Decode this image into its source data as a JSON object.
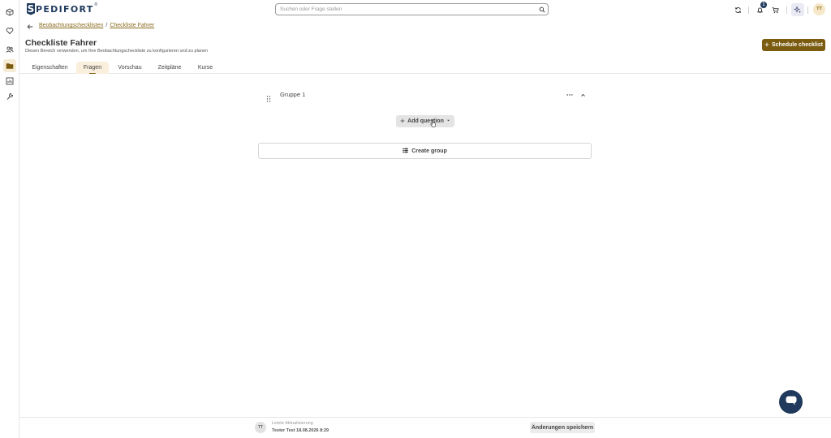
{
  "brand": {
    "name": "PEDIFORT",
    "mark": "S",
    "reg": "®"
  },
  "rail": {
    "items": [
      {
        "name": "cube-icon"
      },
      {
        "name": "heart-icon"
      },
      {
        "name": "users-icon"
      },
      {
        "name": "folder-icon",
        "active": true
      },
      {
        "name": "chart-icon"
      },
      {
        "name": "tools-icon"
      }
    ]
  },
  "search": {
    "placeholder": "Suchen oder Frage stellen",
    "value": ""
  },
  "topbar": {
    "notification_count": "1",
    "avatar_initials": "TT"
  },
  "breadcrumb": {
    "items": [
      "Beobachtungschecklisten",
      "Checkliste Fahrer"
    ],
    "separator": "/"
  },
  "header": {
    "title": "Checkliste Fahrer",
    "description": "Diesen Bereich verwenden, um Ihre Beobachtungscheckliste zu konfigurieren und zu planen",
    "schedule_label": "Schedule checklist"
  },
  "tabs": [
    {
      "label": "Eigenschaften",
      "active": false
    },
    {
      "label": "Fragen",
      "active": true
    },
    {
      "label": "Vorschau",
      "active": false
    },
    {
      "label": "Zeitpläne",
      "active": false
    },
    {
      "label": "Kurse",
      "active": false
    }
  ],
  "group": {
    "title": "Gruppe 1",
    "add_question_label": "Add question",
    "create_group_label": "Create group"
  },
  "footer": {
    "avatar_initials": "TT",
    "last_update_label": "Letzte Aktualisierung",
    "last_update_value": "Tester Test 18.08.2026 8:29",
    "save_label": "Änderungen speichern"
  },
  "colors": {
    "accent": "#7a5b10",
    "brand": "#1f3a5c",
    "tab_active_bg": "#f9efdc"
  }
}
